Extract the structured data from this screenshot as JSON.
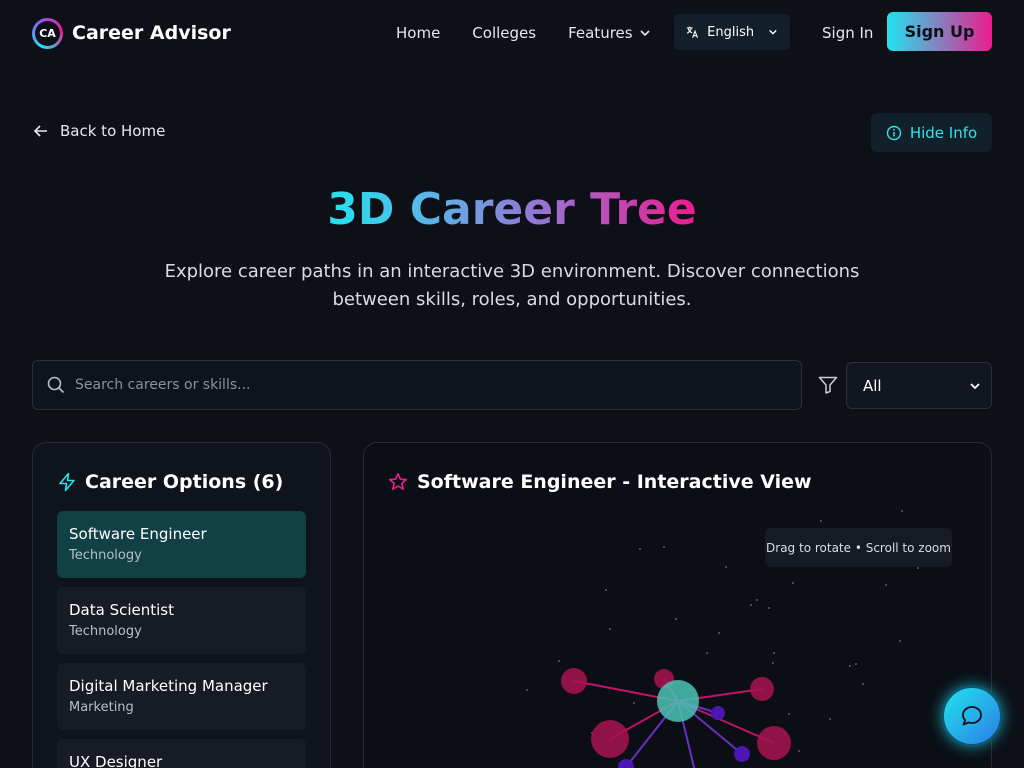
{
  "brand": {
    "logo_text": "CA",
    "name": "Career Advisor"
  },
  "nav": {
    "links": [
      "Home",
      "Colleges",
      "Features"
    ],
    "language": "English",
    "sign_in": "Sign In",
    "sign_up": "Sign Up"
  },
  "colors": {
    "accent_cyan": "#22e3ee",
    "accent_pink": "#ec1c8e",
    "active_card": "#114144",
    "background": "#0d1017"
  },
  "page": {
    "back_label": "Back to Home",
    "hide_info_label": "Hide Info",
    "title": "3D Career Tree",
    "subtitle": "Explore career paths in an interactive 3D environment. Discover connections between skills, roles, and opportunities."
  },
  "search": {
    "placeholder": "Search careers or skills...",
    "value": ""
  },
  "filter": {
    "selected": "All"
  },
  "career_options": {
    "heading": "Career Options (6)",
    "items": [
      {
        "title": "Software Engineer",
        "category": "Technology",
        "active": true
      },
      {
        "title": "Data Scientist",
        "category": "Technology",
        "active": false
      },
      {
        "title": "Digital Marketing Manager",
        "category": "Marketing",
        "active": false
      },
      {
        "title": "UX Designer",
        "category": "",
        "active": false
      }
    ]
  },
  "viewer": {
    "heading": "Software Engineer - Interactive View",
    "hint": "Drag to rotate • Scroll to zoom"
  }
}
